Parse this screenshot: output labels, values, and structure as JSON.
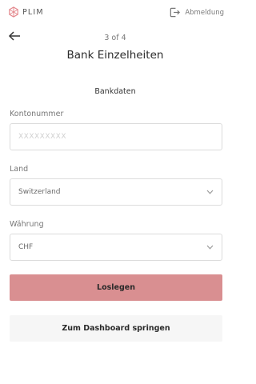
{
  "header": {
    "logo_text": "PLIM",
    "logout_label": "Abmeldung"
  },
  "page": {
    "step": "3 of 4",
    "title": "Bank Einzelheiten",
    "section_title": "Bankdaten"
  },
  "form": {
    "account_number": {
      "label": "Kontonummer",
      "placeholder": "XXXXXXXXX",
      "value": ""
    },
    "country": {
      "label": "Land",
      "value": "Switzerland"
    },
    "currency": {
      "label": "Währung",
      "value": "CHF"
    }
  },
  "actions": {
    "primary_label": "Loslegen",
    "secondary_label": "Zum Dashboard springen"
  },
  "colors": {
    "primary_button": "#d98f91",
    "secondary_button": "#f6f6f6",
    "logo_accent": "#e48a8f"
  },
  "icons": [
    "plim-logo-icon",
    "logout-icon",
    "back-arrow-icon",
    "chevron-down-icon"
  ]
}
